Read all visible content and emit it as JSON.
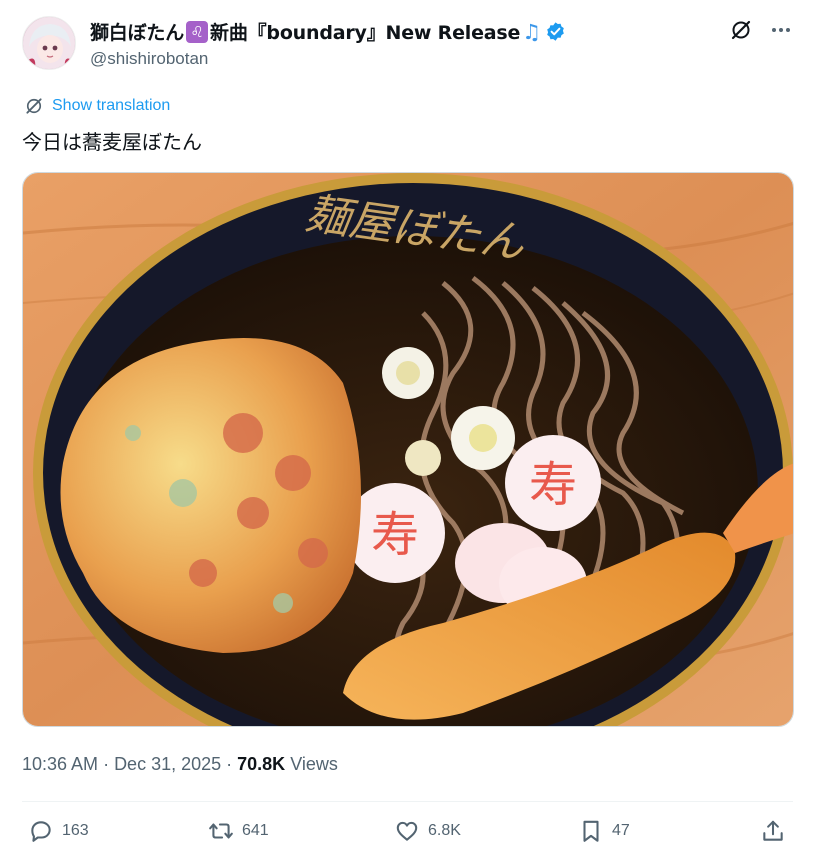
{
  "user": {
    "display_name_prefix": "獅白ぼたん",
    "leo_badge": "♌",
    "display_name_suffix": "新曲『boundary』New Release",
    "music_note": "♫",
    "handle": "@shishirobotan"
  },
  "translate": {
    "label": "Show translation"
  },
  "tweet": {
    "text": "今日は蕎麦屋ぼたん"
  },
  "media": {
    "bowl_text": "麺屋ぼたん",
    "kamaboko_text": "寿"
  },
  "meta": {
    "time": "10:36 AM",
    "separator": " · ",
    "date": "Dec 31, 2025",
    "views_count": "70.8K",
    "views_label": "Views"
  },
  "actions": {
    "replies": "163",
    "reposts": "641",
    "likes": "6.8K",
    "bookmarks": "47"
  },
  "colors": {
    "accent": "#1d9bf0",
    "muted": "#536471",
    "text": "#0f1419"
  }
}
